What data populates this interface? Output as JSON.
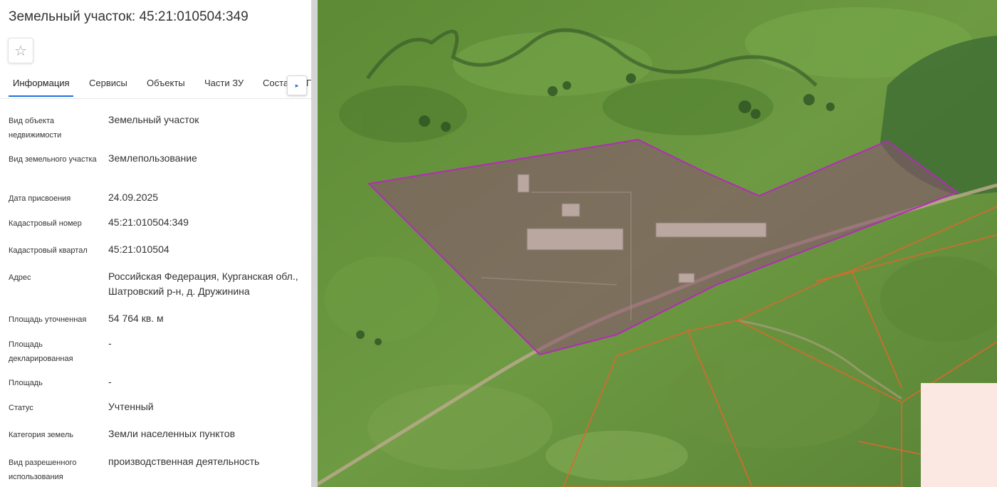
{
  "header": {
    "title": "Земельный участок: 45:21:010504:349"
  },
  "favorite": {
    "icon": "star-outline-icon",
    "glyph": "☆"
  },
  "tabs": [
    {
      "label": "Информация",
      "active": true
    },
    {
      "label": "Сервисы",
      "active": false
    },
    {
      "label": "Объекты",
      "active": false
    },
    {
      "label": "Части ЗУ",
      "active": false
    },
    {
      "label": "Соста",
      "active": false
    }
  ],
  "tab_next": {
    "icon": "caret-right-icon",
    "glyph": "▸"
  },
  "tab_overflow_glyph": "Г",
  "properties": [
    {
      "label": "Вид объекта недвижимости",
      "value": "Земельный участок"
    },
    {
      "label": "Вид земельного участка",
      "value": "Землепользование"
    },
    {
      "label": "Дата присвоения",
      "value": "24.09.2025"
    },
    {
      "label": "Кадастровый номер",
      "value": "45:21:010504:349"
    },
    {
      "label": "Кадастровый квартал",
      "value": "45:21:010504"
    },
    {
      "label": "Адрес",
      "value": "Российская Федерация, Курганская обл., Шатровский р-н, д. Дружинина"
    },
    {
      "label": "Площадь уточненная",
      "value": "54 764 кв. м"
    },
    {
      "label": "Площадь декларированная",
      "value": "-"
    },
    {
      "label": "Площадь",
      "value": "-"
    },
    {
      "label": "Статус",
      "value": "Учтенный"
    },
    {
      "label": "Категория земель",
      "value": "Земли населенных пунктов"
    },
    {
      "label": "Вид разрешенного использования",
      "value": "производственная деятельность"
    }
  ],
  "map": {
    "type": "satellite",
    "colors": {
      "vegetation": "#5f8f3a",
      "selected_parcel_outline": "#b42bb8",
      "selected_parcel_fill": "#7a4a6a",
      "neighbor_parcel_outline": "#e0662e",
      "neighbor_fill": "#fbe8e2"
    }
  }
}
